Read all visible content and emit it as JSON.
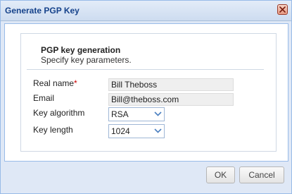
{
  "dialog": {
    "title": "Generate PGP Key",
    "close_icon": "close-icon"
  },
  "section": {
    "title": "PGP key generation",
    "subtitle": "Specify key parameters."
  },
  "form": {
    "real_name": {
      "label": "Real name",
      "required_marker": "*",
      "value": "Bill Theboss"
    },
    "email": {
      "label": "Email",
      "value": "Bill@theboss.com"
    },
    "key_algorithm": {
      "label": "Key algorithm",
      "value": "RSA",
      "icon": "chevron-down-icon"
    },
    "key_length": {
      "label": "Key length",
      "value": "1024",
      "icon": "chevron-down-icon"
    }
  },
  "buttons": {
    "ok": "OK",
    "cancel": "Cancel"
  },
  "colors": {
    "title_text": "#15428b",
    "frame_border": "#99bbe8",
    "frame_bg": "#dfe8f6",
    "required": "#cc0000",
    "chevron": "#4a7fc0"
  }
}
